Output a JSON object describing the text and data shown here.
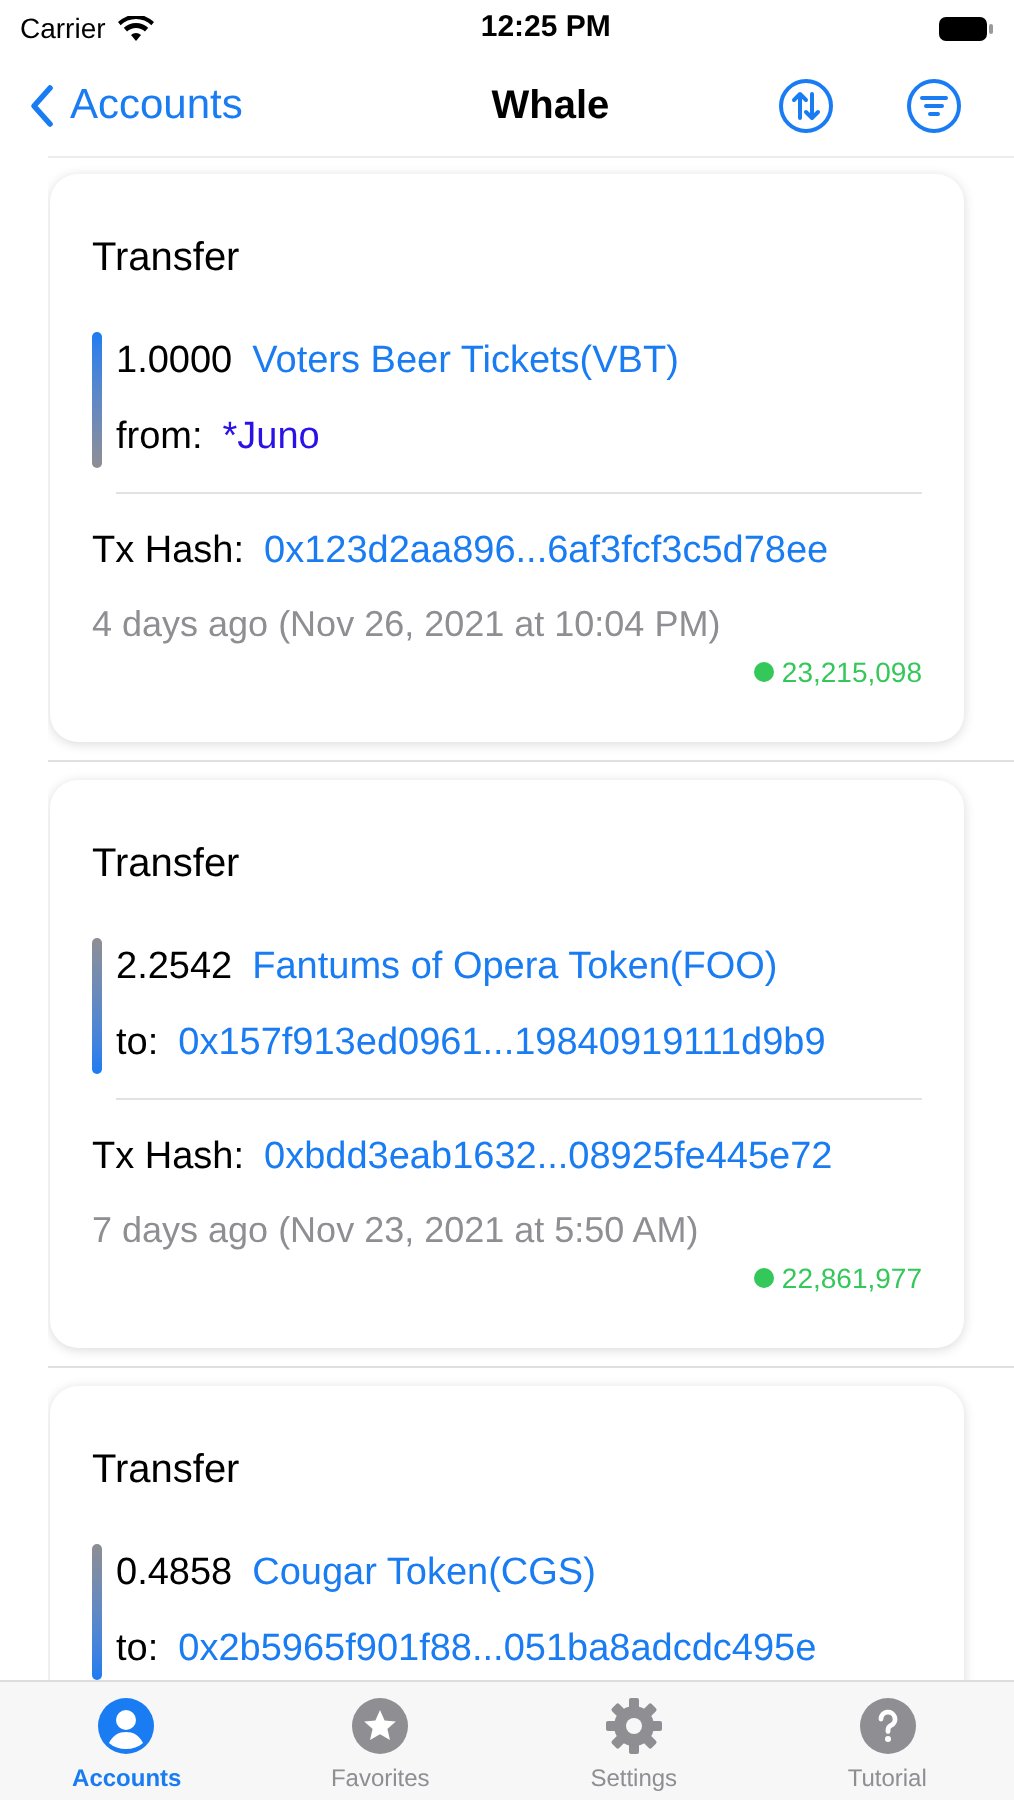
{
  "status_bar": {
    "carrier": "Carrier",
    "time": "12:25 PM"
  },
  "nav": {
    "back": "Accounts",
    "title": "Whale"
  },
  "transactions": [
    {
      "type": "Transfer",
      "amount": "1.0000",
      "token": "Voters Beer Tickets(VBT)",
      "kind": "incoming",
      "party_label": "from:",
      "party": {
        "kind": "name",
        "text": "*Juno"
      },
      "hash_label": "Tx Hash:",
      "hash": "0x123d2aa896...6af3fcf3c5d78ee",
      "time": "4 days ago (Nov 26, 2021 at 10:04 PM)",
      "block": {
        "text": "23,215,098",
        "color": "#34c759"
      }
    },
    {
      "type": "Transfer",
      "amount": "2.2542",
      "token": "Fantums of Opera Token(FOO)",
      "kind": "outgoing",
      "party_label": "to:",
      "party": {
        "kind": "address",
        "text": "0x157f913ed0961...19840919111d9b9"
      },
      "hash_label": "Tx Hash:",
      "hash": "0xbdd3eab1632...08925fe445e72",
      "time": "7 days ago (Nov 23, 2021 at 5:50 AM)",
      "block": {
        "text": "22,861,977",
        "color": "#34c759"
      }
    },
    {
      "type": "Transfer",
      "amount": "0.4858",
      "token": "Cougar Token(CGS)",
      "kind": "outgoing",
      "party_label": "to:",
      "party": {
        "kind": "address",
        "text": "0x2b5965f901f88...051ba8adcdc495e"
      }
    }
  ],
  "tabs": [
    {
      "label": "Accounts",
      "selected": true
    },
    {
      "label": "Favorites",
      "selected": false
    },
    {
      "label": "Settings",
      "selected": false
    },
    {
      "label": "Tutorial",
      "selected": false
    }
  ]
}
